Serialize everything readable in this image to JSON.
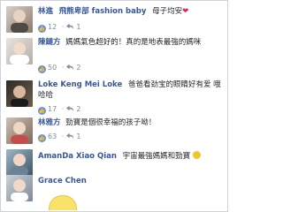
{
  "comments": [
    {
      "name": "林進",
      "body": "飛熊卑部 fashion baby",
      "extra": "母子均安",
      "likes": "12",
      "replies": "1"
    },
    {
      "name": "陳鏈方",
      "body": "媽媽氣色超好的！真的是地表最強的媽咪",
      "likes": "50",
      "replies": "2"
    },
    {
      "name": "Loke Keng Mei Loke",
      "body": "爸爸看劲宝的眼睛好有爱 哦哈哈",
      "likes": "17",
      "replies": "2"
    },
    {
      "name": "林雅方",
      "body": "勁寶是個很幸福的孩子呦！",
      "likes": "63",
      "replies": "1"
    },
    {
      "name": "AmanDa Xiao Qian",
      "body": "宇宙最強媽媽和勁寶",
      "likes": "",
      "replies": ""
    },
    {
      "name": "Grace Chen",
      "body": "",
      "likes": "",
      "replies": ""
    }
  ],
  "icons": {
    "like": "like-icon",
    "reply": "reply-icon",
    "heart": "heart-icon"
  },
  "colors": {
    "name": "#365899",
    "like": "#5890ff",
    "meta": "#7f8c9d"
  }
}
